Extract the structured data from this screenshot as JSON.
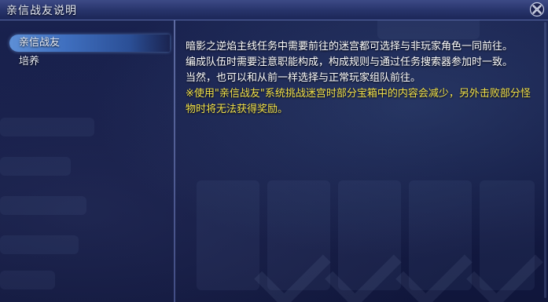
{
  "window": {
    "title": "亲信战友说明",
    "close_icon": "close-x-icon"
  },
  "sidebar": {
    "items": [
      {
        "label": "亲信战友",
        "selected": true
      },
      {
        "label": "培养",
        "selected": false
      }
    ]
  },
  "content": {
    "paragraphs": [
      "暗影之逆焰主线任务中需要前往的迷宫都可选择与非玩家角色一同前往。",
      "编成队伍时需要注意职能构成，构成规则与通过任务搜索器参加时一致。",
      "当然，也可以和从前一样选择与正常玩家组队前往。"
    ],
    "note": "※使用\"亲信战友\"系统挑战迷宫时部分宝箱中的内容会减少，另外击败部分怪物时将无法获得奖励。"
  },
  "colors": {
    "note_text": "#f3e24a",
    "body_text": "#ffffff",
    "selected_item": "#3f6fbf"
  }
}
